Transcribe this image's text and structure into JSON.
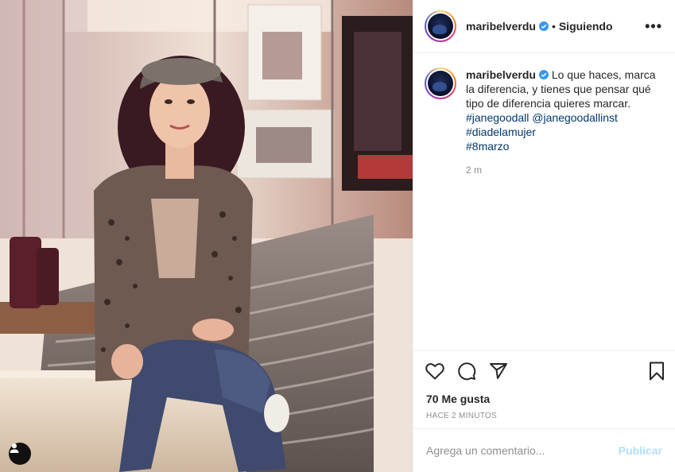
{
  "post": {
    "username": "maribelverdu",
    "separator": "•",
    "follow_status": "Siguiendo",
    "more_icon": "more-options-icon",
    "more_label": "•••",
    "caption": {
      "text": "Lo que haces, marca la diferencia, y tienes que pensar qué tipo de diferencia quieres marcar.",
      "hashtag_1": "#janegoodall",
      "mention": "@janegoodallinst",
      "hashtag_2": "#diadelamujer",
      "hashtag_3": "#8marzo"
    },
    "caption_time": "2 m",
    "likes": "70 Me gusta",
    "timestamp": "HACE 2 MINUTOS",
    "comment_placeholder": "Agrega un comentario...",
    "publish_label": "Publicar"
  },
  "icons": {
    "like": "heart-icon",
    "comment": "comment-icon",
    "share": "share-icon",
    "save": "bookmark-icon",
    "verified": "verified-badge-icon",
    "tag": "user-tag-icon"
  },
  "colors": {
    "text": "#262626",
    "link": "#00376b",
    "muted": "#8e8e8e",
    "publish_disabled": "#b2dffc",
    "verified": "#3897f0",
    "border": "#efefef"
  }
}
